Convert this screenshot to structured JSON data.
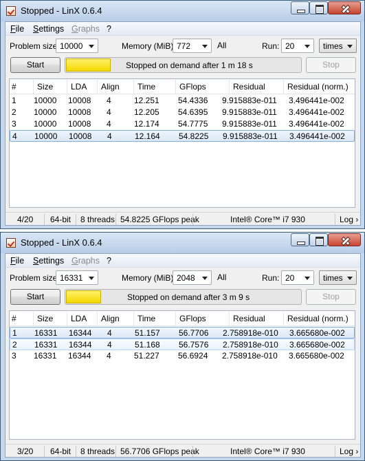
{
  "windows": [
    {
      "title": "Stopped - LinX 0.6.4",
      "menu": {
        "file": "File",
        "settings": "Settings",
        "graphs": "Graphs",
        "help": "?"
      },
      "controls": {
        "problem_size_label": "Problem size:",
        "problem_size": "10000",
        "memory_label": "Memory (MiB):",
        "memory": "772",
        "all_label": "All",
        "run_label": "Run:",
        "run": "20",
        "run_unit": "times",
        "start_label": "Start",
        "stop_label": "Stop",
        "progress": 0.19,
        "status": "Stopped on demand after 1 m 18 s"
      },
      "columns": [
        "#",
        "Size",
        "LDA",
        "Align",
        "Time",
        "GFlops",
        "Residual",
        "Residual (norm.)"
      ],
      "rows": [
        [
          "1",
          "10000",
          "10008",
          "4",
          "12.251",
          "54.4336",
          "9.915883e-011",
          "3.496441e-002"
        ],
        [
          "2",
          "10000",
          "10008",
          "4",
          "12.205",
          "54.6395",
          "9.915883e-011",
          "3.496441e-002"
        ],
        [
          "3",
          "10000",
          "10008",
          "4",
          "12.174",
          "54.7775",
          "9.915883e-011",
          "3.496441e-002"
        ],
        [
          "4",
          "10000",
          "10008",
          "4",
          "12.164",
          "54.8225",
          "9.915883e-011",
          "3.496441e-002"
        ]
      ],
      "status": {
        "runs": "4/20",
        "bits": "64-bit",
        "threads": "8 threads",
        "peak": "54.8225 GFlops peak",
        "cpu": "Intel® Core™ i7 930",
        "log": "Log ›"
      }
    },
    {
      "title": "Stopped - LinX 0.6.4",
      "menu": {
        "file": "File",
        "settings": "Settings",
        "graphs": "Graphs",
        "help": "?"
      },
      "controls": {
        "problem_size_label": "Problem size:",
        "problem_size": "16331",
        "memory_label": "Memory (MiB):",
        "memory": "2048",
        "all_label": "All",
        "run_label": "Run:",
        "run": "20",
        "run_unit": "times",
        "start_label": "Start",
        "stop_label": "Stop",
        "progress": 0.15,
        "status": "Stopped on demand after 3 m 9 s"
      },
      "columns": [
        "#",
        "Size",
        "LDA",
        "Align",
        "Time",
        "GFlops",
        "Residual",
        "Residual (norm.)"
      ],
      "rows": [
        [
          "1",
          "16331",
          "16344",
          "4",
          "51.157",
          "56.7706",
          "2.758918e-010",
          "3.665680e-002"
        ],
        [
          "2",
          "16331",
          "16344",
          "4",
          "51.168",
          "56.7576",
          "2.758918e-010",
          "3.665680e-002"
        ],
        [
          "3",
          "16331",
          "16344",
          "4",
          "51.227",
          "56.6924",
          "2.758918e-010",
          "3.665680e-002"
        ]
      ],
      "status": {
        "runs": "3/20",
        "bits": "64-bit",
        "threads": "8 threads",
        "peak": "56.7706 GFlops peak",
        "cpu": "Intel® Core™ i7 930",
        "log": "Log ›"
      }
    }
  ]
}
